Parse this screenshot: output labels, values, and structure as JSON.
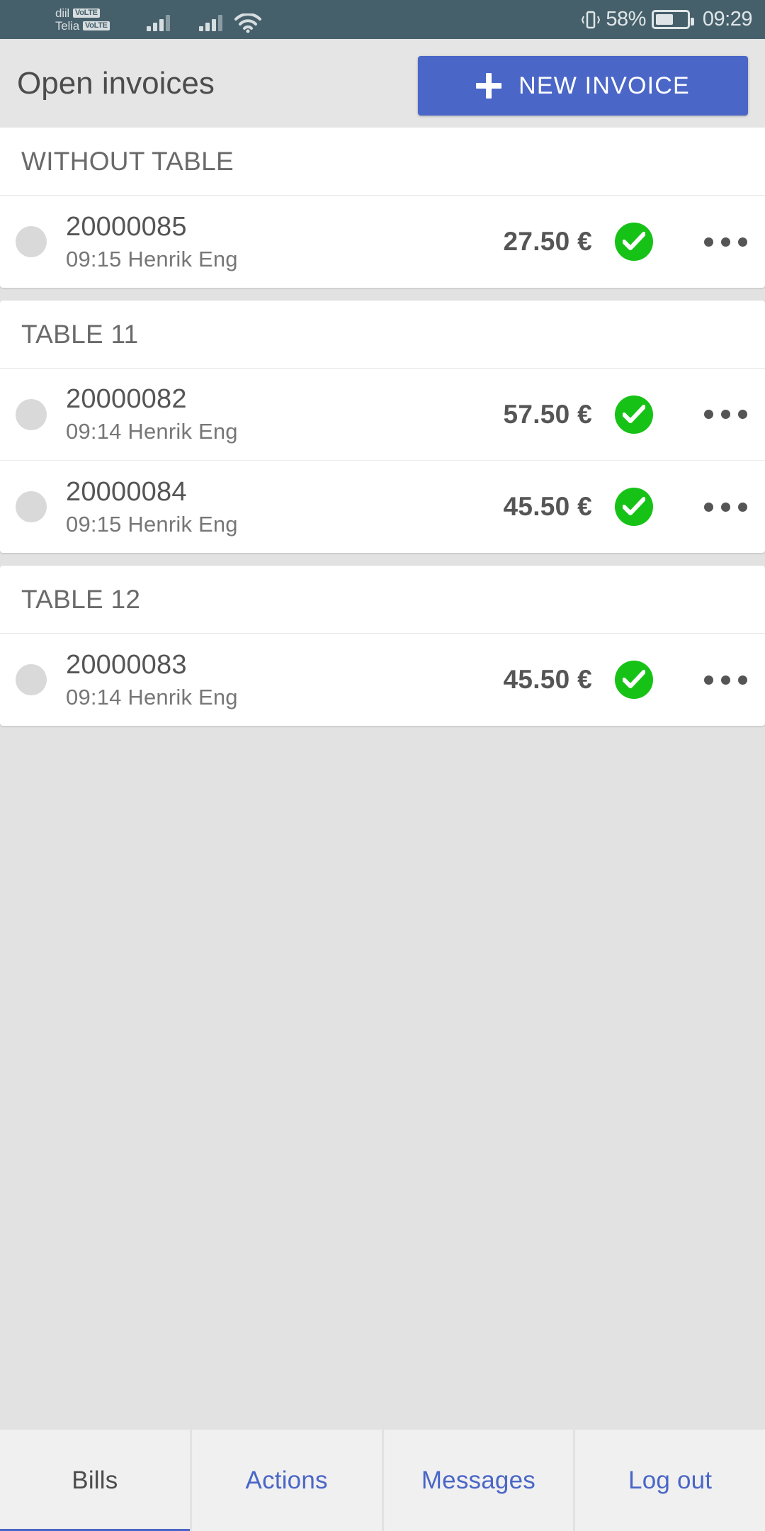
{
  "status_bar": {
    "carriers": [
      {
        "name": "diil",
        "tag": "VoLTE"
      },
      {
        "name": "Telia",
        "tag": "VoLTE"
      }
    ],
    "battery_percent": "58%",
    "time": "09:29",
    "icons": [
      "signal-bars-icon",
      "signal-bars-icon",
      "wifi-icon",
      "vibrate-icon",
      "battery-icon"
    ]
  },
  "header": {
    "title": "Open invoices",
    "new_invoice_label": "NEW INVOICE"
  },
  "sections": [
    {
      "title": "WITHOUT TABLE",
      "rows": [
        {
          "number": "20000085",
          "sub": "09:15 Henrik Eng",
          "amount": "27.50 €",
          "status": "paid"
        }
      ]
    },
    {
      "title": "TABLE 11",
      "rows": [
        {
          "number": "20000082",
          "sub": "09:14 Henrik Eng",
          "amount": "57.50 €",
          "status": "paid"
        },
        {
          "number": "20000084",
          "sub": "09:15 Henrik Eng",
          "amount": "45.50 €",
          "status": "paid"
        }
      ]
    },
    {
      "title": "TABLE 12",
      "rows": [
        {
          "number": "20000083",
          "sub": "09:14 Henrik Eng",
          "amount": "45.50 €",
          "status": "paid"
        }
      ]
    }
  ],
  "tabs": [
    {
      "label": "Bills",
      "active": true
    },
    {
      "label": "Actions",
      "active": false
    },
    {
      "label": "Messages",
      "active": false
    },
    {
      "label": "Log out",
      "active": false
    }
  ],
  "colors": {
    "accent": "#4a66c7",
    "status_ok": "#17c217",
    "status_bar_bg": "#46606b",
    "page_bg": "#e2e2e2"
  }
}
